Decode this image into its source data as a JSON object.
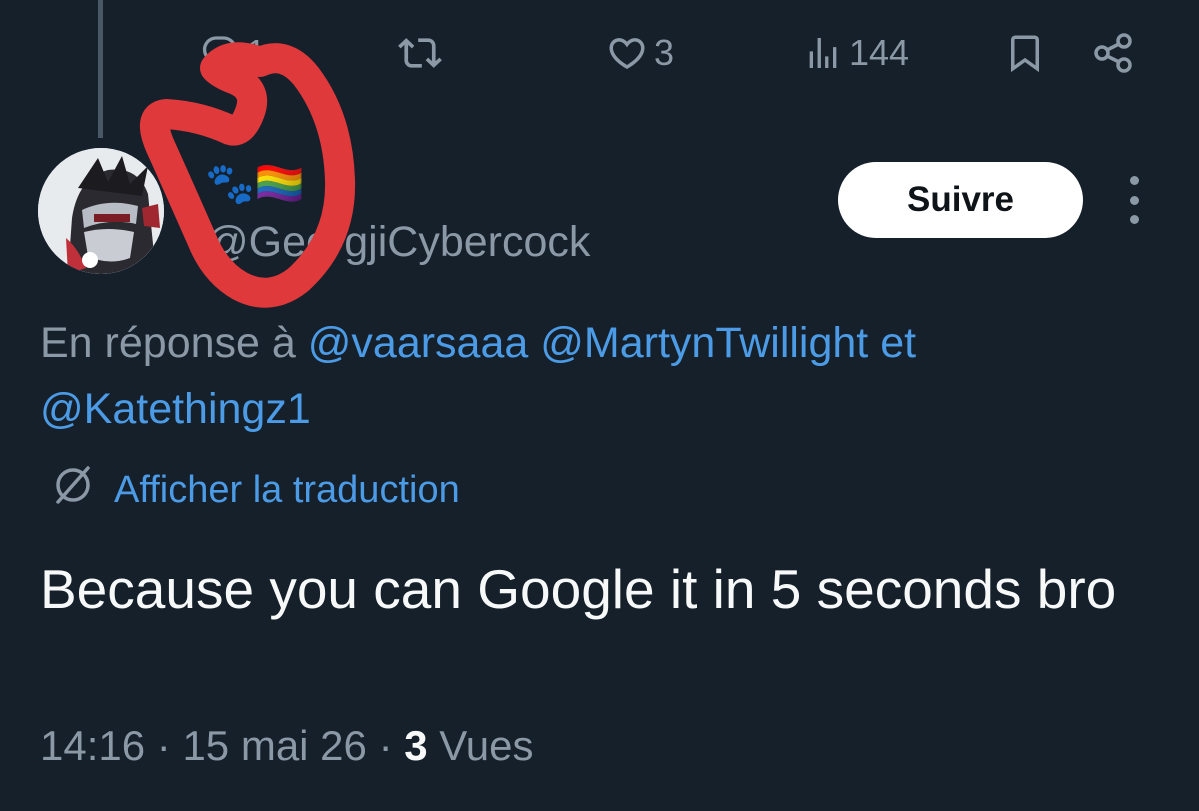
{
  "previous_tweet_actions": {
    "reply_count": "1",
    "like_count": "3",
    "views_count": "144"
  },
  "tweet": {
    "emoji": "🐾🏳️‍🌈",
    "handle": "@GeorgjiCybercock",
    "follow_label": "Suivre",
    "reply_prefix": "En réponse à",
    "mentions": [
      "@vaarsaaa",
      "@MartynTwillight"
    ],
    "conjunction": "et",
    "last_mention": "@Katethingz1",
    "translate_label": "Afficher la traduction",
    "text": "Because you can Google it in 5 seconds bro",
    "time": "14:16",
    "date": "15 mai 26",
    "separator": "·",
    "views_number": "3",
    "views_label": "Vues"
  },
  "colors": {
    "background": "#15202b",
    "link": "#4c9be6",
    "muted": "#8b98a5",
    "annotation": "#e0393b"
  }
}
